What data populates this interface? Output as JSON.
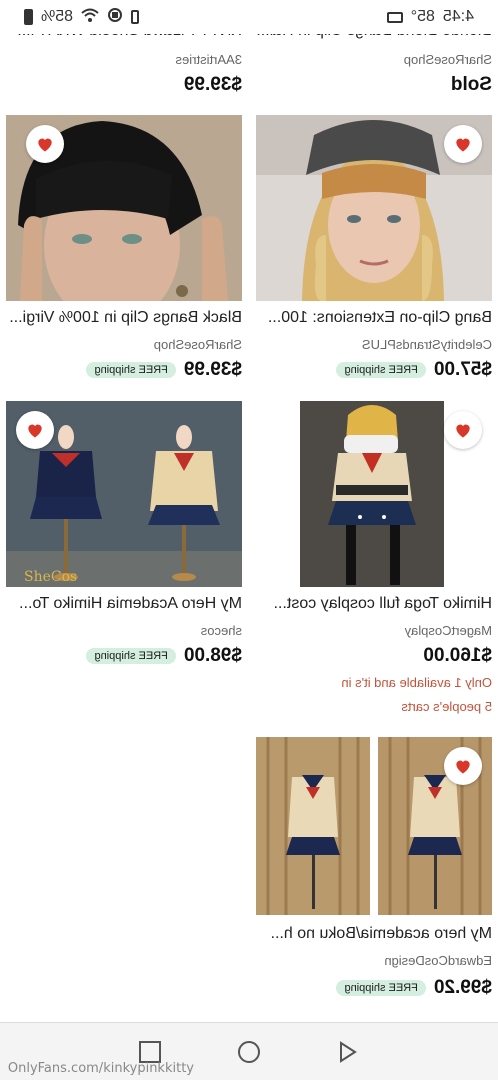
{
  "status_bar": {
    "time": "4:45",
    "temperature": "85°",
    "battery": "85%",
    "icons": [
      "tv-icon",
      "vibrate-icon",
      "sync-icon",
      "wifi-icon",
      "battery-icon"
    ]
  },
  "top_row": {
    "left_title": "Blonde Blond Bangs Clip in Hai...",
    "left_shop": "SharRoseShop",
    "left_status": "Sold",
    "right_title": "KNTY Pizawd Shoeid WKA Pi...",
    "right_shop": "3AArtistries",
    "right_price": "$39.99"
  },
  "cards": [
    {
      "title": "Black Bangs Clip in 100% Virgi...",
      "shop": "SharRoseShop",
      "price": "$39.99",
      "free_shipping": "FREE shipping"
    },
    {
      "title": "Bang Clip-on Extensions: 100...",
      "shop": "CelebrityStrandsPLUS",
      "price": "$57.00",
      "free_shipping": "FREE shipping"
    },
    {
      "title": "My Hero Academia Himiko To...",
      "shop": "shecos",
      "price": "$98.00",
      "free_shipping": "FREE shipping"
    },
    {
      "title": "Himiko Toga full cosplay cost...",
      "shop": "MagertCosplay",
      "price": "$160.00",
      "note_line1": "Only 1 available and it's in",
      "note_line2": "5 people's carts"
    },
    {
      "title": "My hero academia/Boku no h...",
      "shop": "EdwardCosDesign",
      "price": "$99.20",
      "free_shipping": "FREE shipping"
    }
  ],
  "watermark": "OnlyFans.com/kinkypinkkitty",
  "colors": {
    "heart": "#d8372a",
    "free_badge_bg": "#d4eedf",
    "note_text": "#c4533a"
  },
  "nav_icons": [
    "back-icon",
    "home-icon",
    "recents-icon"
  ]
}
